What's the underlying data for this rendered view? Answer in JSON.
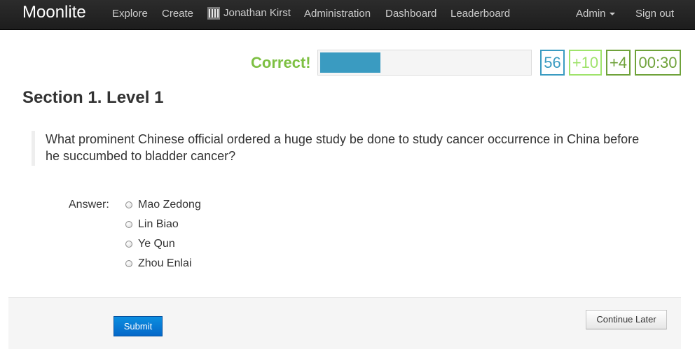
{
  "navbar": {
    "brand": "Moonlite",
    "links": {
      "explore": "Explore",
      "create": "Create",
      "user": "Jonathan Kirst",
      "administration": "Administration",
      "dashboard": "Dashboard",
      "leaderboard": "Leaderboard",
      "admin": "Admin",
      "sign_out": "Sign out"
    }
  },
  "status": {
    "feedback": "Correct!",
    "progress_fraction": 0.29,
    "score": "56",
    "bonus": "+10",
    "streak": "+4",
    "timer": "00:30",
    "colors": {
      "feedback": "#7ec043",
      "progress": "#3a9bc1",
      "score": "#3a9bc1",
      "bonus": "#9fe36b",
      "streak": "#6fa23a",
      "timer": "#6fa23a"
    }
  },
  "section": {
    "title": "Section 1. Level 1"
  },
  "question": {
    "text": "What prominent Chinese official ordered a huge study be done to study cancer occurrence in China before he succumbed to bladder cancer?"
  },
  "answer": {
    "label": "Answer:",
    "options": [
      "Mao Zedong",
      "Lin Biao",
      "Ye Qun",
      "Zhou Enlai"
    ],
    "selected": null
  },
  "actions": {
    "submit": "Submit",
    "continue_later": "Continue Later"
  }
}
